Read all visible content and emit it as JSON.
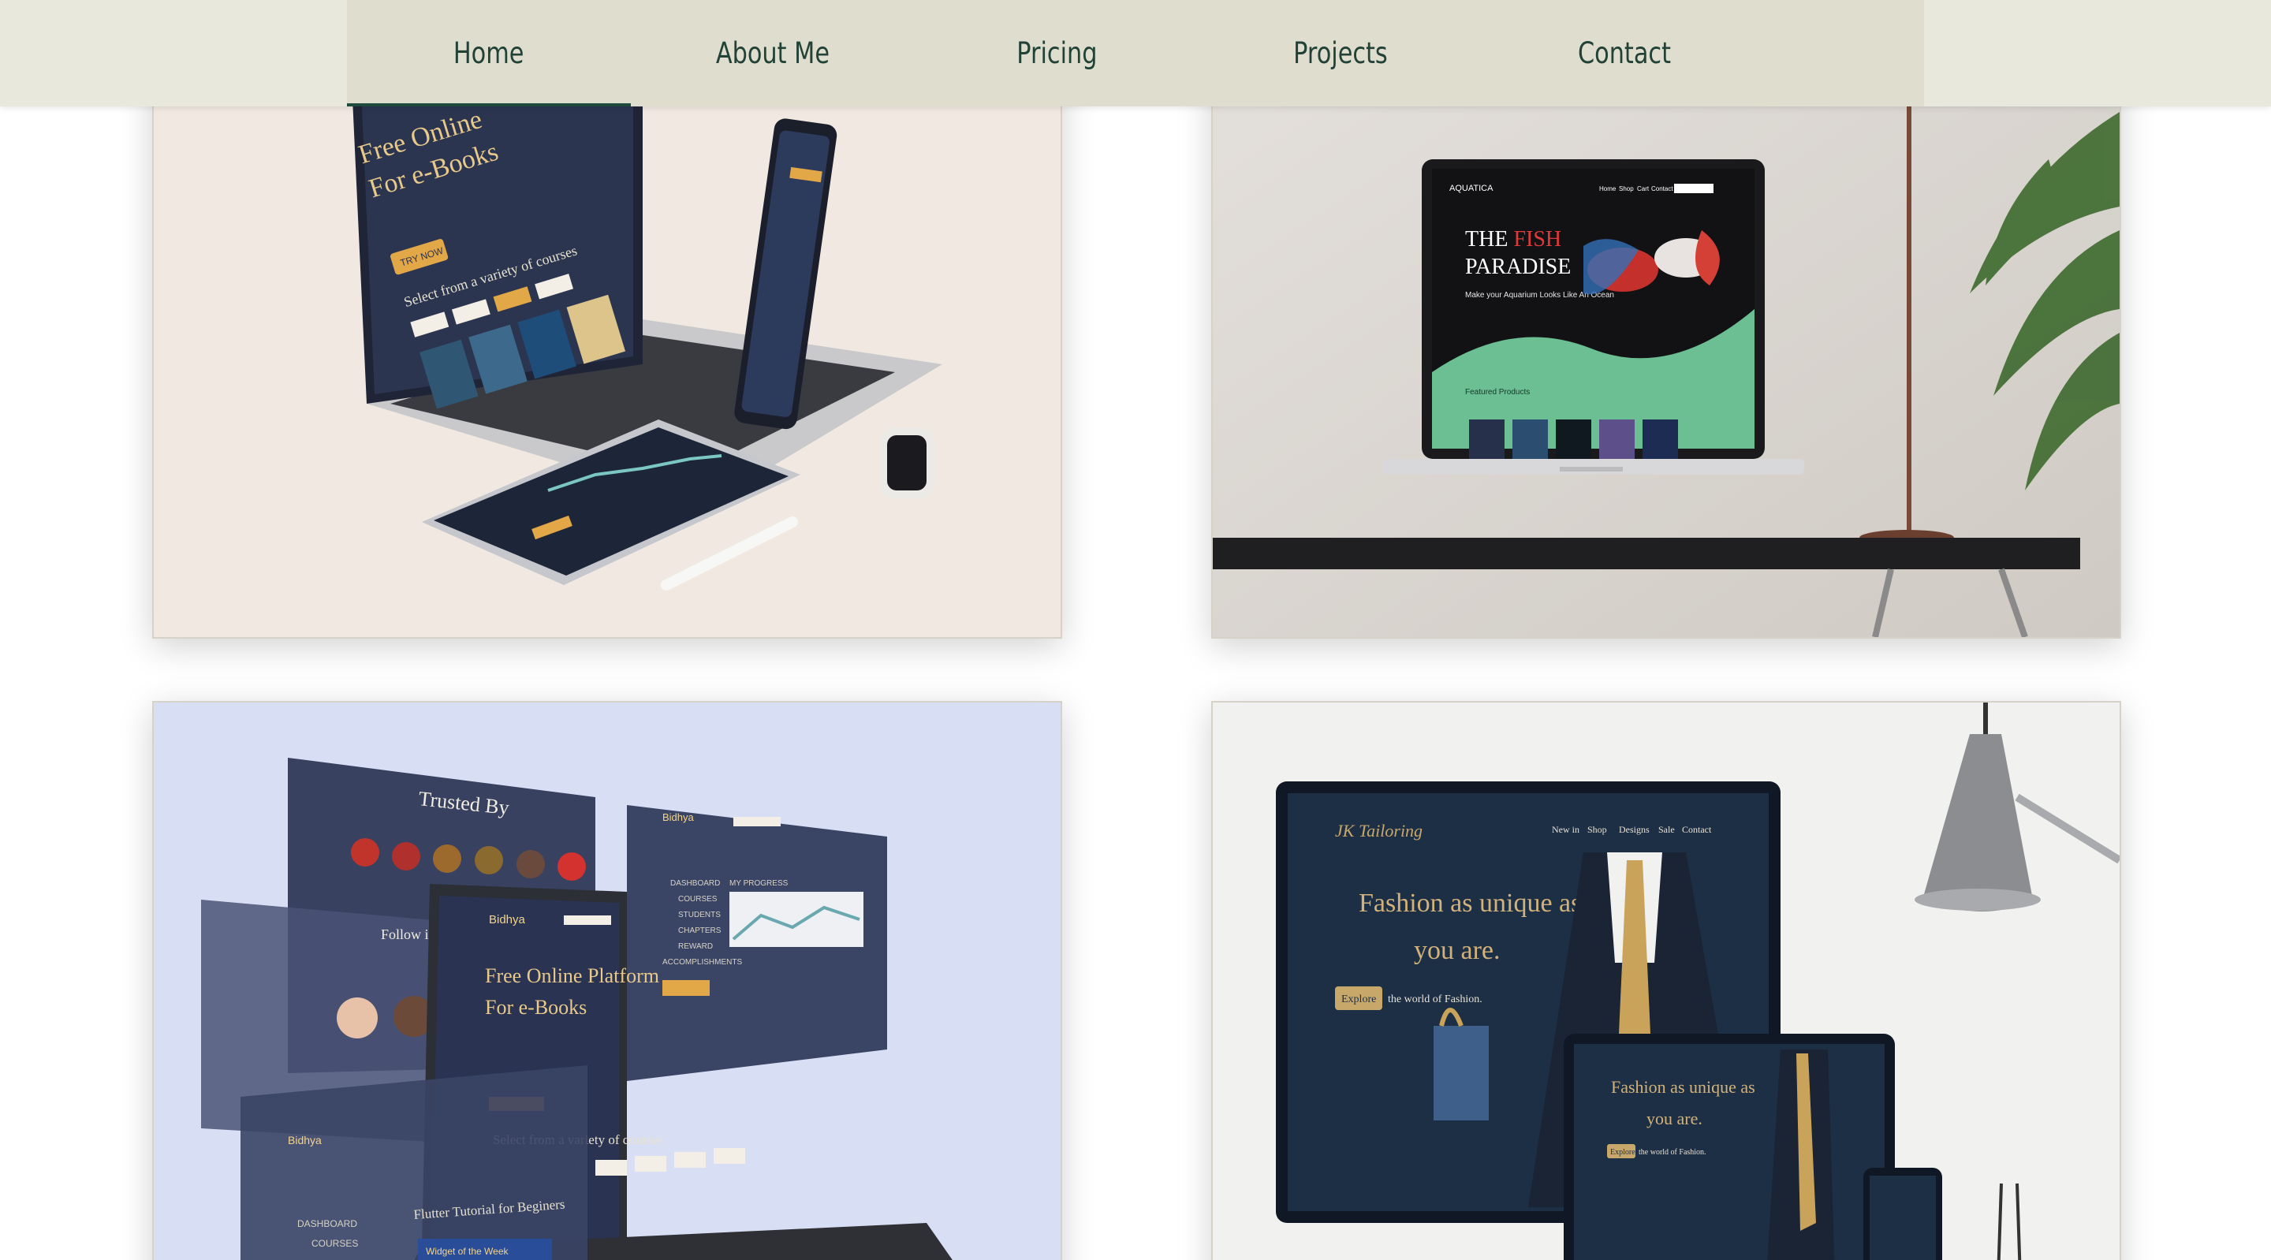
{
  "nav": {
    "items": [
      {
        "label": "Home",
        "active": true
      },
      {
        "label": "About Me",
        "active": false
      },
      {
        "label": "Pricing",
        "active": false
      },
      {
        "label": "Projects",
        "active": false
      },
      {
        "label": "Contact",
        "active": false
      }
    ]
  },
  "colors": {
    "nav_bg": "#deddce",
    "topbar_bg": "#e9e8dc",
    "nav_text": "#224137",
    "accent": "#1f4a3d"
  },
  "projects": [
    {
      "name": "bidhya-mockup",
      "screen": {
        "hero_line1": "Free Online",
        "hero_line2": "For e-Books",
        "cta": "TRY NOW",
        "courses_heading": "Select from a variety of courses"
      }
    },
    {
      "name": "aquatica-mockup",
      "screen": {
        "brand": "AQUATICA",
        "nav": [
          "Home",
          "Shop",
          "Cart",
          "Contact"
        ],
        "headline_a": "THE ",
        "headline_fish": "FISH",
        "headline_b": "PARADISE",
        "tagline": "Make your Aquarium Looks Like An Ocean",
        "featured": "Featured Products"
      }
    },
    {
      "name": "bidhya-panels",
      "screen": {
        "trusted_by": "Trusted By",
        "follow": "Follow in the",
        "brand": "Bidhya",
        "hero_line1": "Free Online Platform",
        "hero_line2": "For e-Books",
        "courses_heading": "Select from a variety of courses",
        "dashboard": "DASHBOARD",
        "courses": "COURSES",
        "tutorial": "Flutter Tutorial for Beginers",
        "widget": "Widget of the Week",
        "menu": [
          "DASHBOARD",
          "COURSES",
          "STUDENTS",
          "CHAPTERS",
          "REWARD",
          "ACCOMPLISHMENTS"
        ],
        "progress": "MY PROGRESS"
      }
    },
    {
      "name": "jk-tailoring-mockup",
      "screen": {
        "brand": "JK Tailoring",
        "nav": [
          "New in",
          "Shop",
          "Designs",
          "Sale",
          "Contact"
        ],
        "headline1": "Fashion as unique as",
        "headline2": "you are.",
        "cta": "Explore",
        "cta_suffix": "the world of Fashion."
      }
    }
  ]
}
